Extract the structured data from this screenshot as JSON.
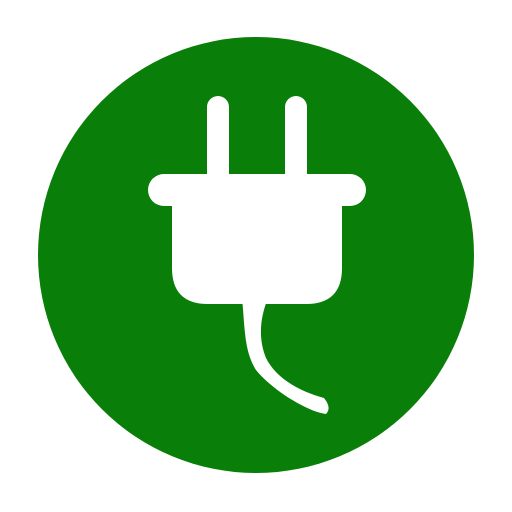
{
  "icon": {
    "name": "power-plug-icon",
    "background_color": "#ffffff",
    "circle_color": "#097f09",
    "glyph_color": "#ffffff"
  }
}
